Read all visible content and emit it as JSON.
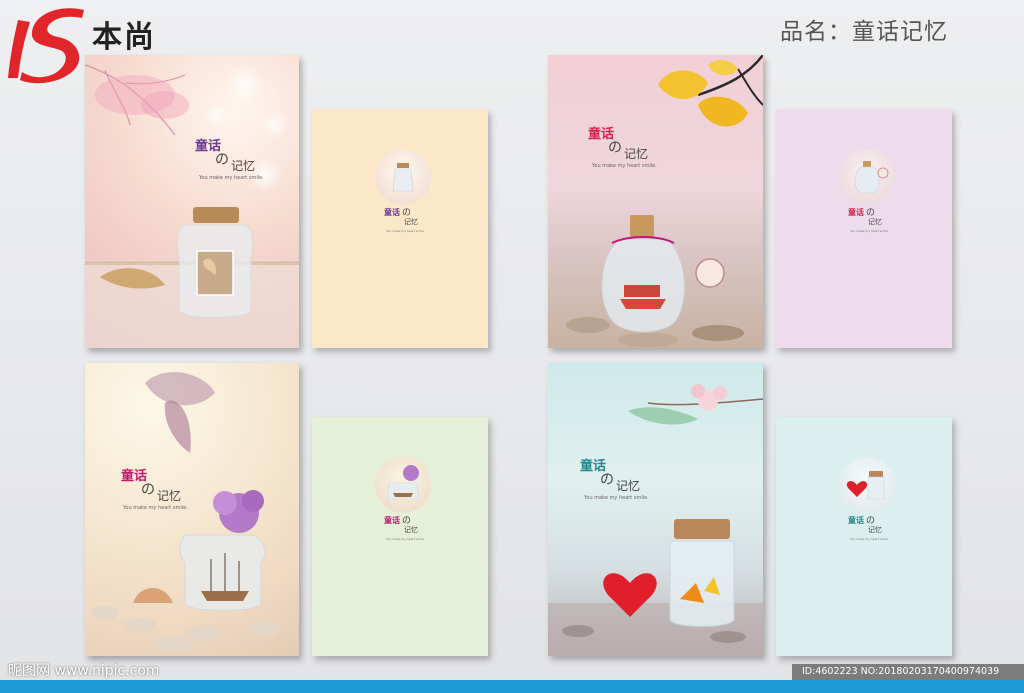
{
  "header": {
    "brand": "本尚",
    "product_title": "品名：童话记忆"
  },
  "design": {
    "title_main": "童话",
    "title_no": "の",
    "title_sub": "记忆",
    "tagline": "You make my heart smile."
  },
  "colors": {
    "logo_red": "#e0262b",
    "title_purple": "#6a3a9a",
    "title_red": "#d4244d",
    "title_pink": "#c2186d",
    "title_teal": "#1e8a8c"
  },
  "sets": [
    {
      "id": "set-1",
      "cover_theme": "peach-bokeh-jar",
      "title_color": "#6a3a9a",
      "back_color": "#fbe8c8"
    },
    {
      "id": "set-2",
      "cover_theme": "yellow-leaves-boat-jar",
      "title_color": "#d4244d",
      "back_color": "#ecdcec"
    },
    {
      "id": "set-3",
      "cover_theme": "purple-flower-ship-jar",
      "title_color": "#c2186d",
      "back_color": "#e6f0d8"
    },
    {
      "id": "set-4",
      "cover_theme": "teal-cork-jar-heart",
      "title_color": "#1e8a8c",
      "back_color": "#dbf0ee"
    }
  ],
  "footer": {
    "watermark_left": "昵图网 www.nipic.com",
    "watermark_right": "ID:4602223 NO:20180203170400974039"
  }
}
